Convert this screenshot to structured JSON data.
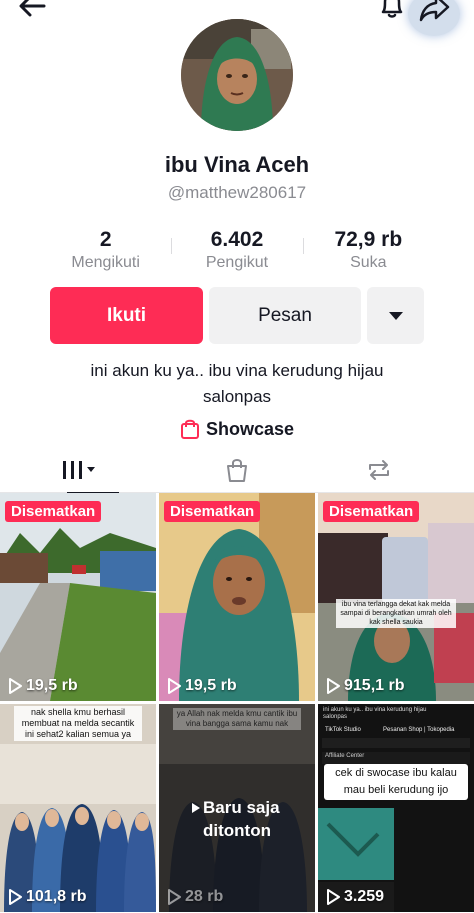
{
  "profile": {
    "name": "ibu Vina Aceh",
    "handle": "@matthew280617",
    "bio": "ini akun ku ya.. ibu vina kerudung hijau salonpas"
  },
  "stats": [
    {
      "value": "2",
      "label": "Mengikuti"
    },
    {
      "value": "6.402",
      "label": "Pengikut"
    },
    {
      "value": "72,9 rb",
      "label": "Suka"
    }
  ],
  "actions": {
    "follow": "Ikuti",
    "message": "Pesan"
  },
  "showcase": {
    "label": "Showcase"
  },
  "colors": {
    "accent": "#fe2c55",
    "secondary_button": "#f1f1f2"
  },
  "videos": [
    {
      "pinned": "Disematkan",
      "views": "19,5 rb"
    },
    {
      "pinned": "Disematkan",
      "views": "19,5 rb"
    },
    {
      "pinned": "Disematkan",
      "views": "915,1 rb",
      "caption": "ibu vina terlangga dekat kak melda sampai di berangkatkan umrah oleh kak shella saukia"
    },
    {
      "views": "101,8 rb",
      "caption": "nak shella kmu berhasil membuat na melda secantik ini sehat2 kalian semua ya"
    },
    {
      "views": "28 rb",
      "overlay": "Baru saja ditonton",
      "caption": "ya Allah nak melda kmu cantik ibu vina bangga sama kamu nak"
    },
    {
      "views": "3.259",
      "caption": "cek di swocase ibu kalau mau beli kerudung ijo",
      "header_caption": "ini akun ku ya.. ibu vina kerudung hijau salonpas",
      "studio": "TikTok Studio",
      "shop": "Pesanan Shop | Tokopedia",
      "affiliate": "Affiliate Center"
    }
  ]
}
